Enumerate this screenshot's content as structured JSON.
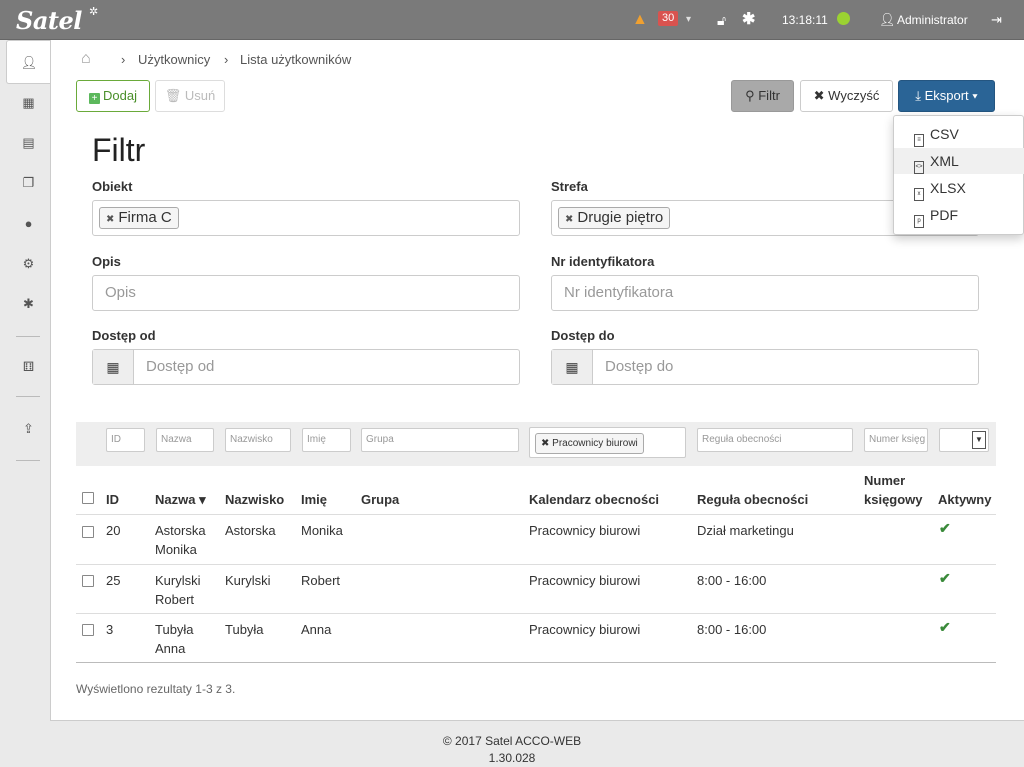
{
  "topbar": {
    "logo": "Satel",
    "alert_count": "30",
    "time": "13:18:11",
    "user": "Administrator",
    "status_color": "#9bd232"
  },
  "breadcrumb": {
    "item1": "Użytkownicy",
    "item2": "Lista użytkowników"
  },
  "toolbar": {
    "add": "Dodaj",
    "delete": "Usuń",
    "filter": "Filtr",
    "clear": "Wyczyść",
    "export": "Eksport"
  },
  "export_menu": [
    {
      "label": "CSV",
      "icon": "csv-file-icon"
    },
    {
      "label": "XML",
      "icon": "xml-file-icon"
    },
    {
      "label": "XLSX",
      "icon": "xlsx-file-icon"
    },
    {
      "label": "PDF",
      "icon": "pdf-file-icon"
    }
  ],
  "filter": {
    "title": "Filtr",
    "object_label": "Obiekt",
    "object_value": "Firma C",
    "zone_label": "Strefa",
    "zone_value": "Drugie piętro",
    "desc_label": "Opis",
    "desc_placeholder": "Opis",
    "card_label": "Nr identyfikatora",
    "card_placeholder": "Nr identyfikatora",
    "from_label": "Dostęp od",
    "from_placeholder": "Dostęp od",
    "to_label": "Dostęp do",
    "to_placeholder": "Dostęp do"
  },
  "table_filters": {
    "id": "ID",
    "name": "Nazwa",
    "surname": "Nazwisko",
    "first": "Imię",
    "group": "Grupa",
    "calendar_tag": "Pracownicy biurowi",
    "rule": "Reguła obecności",
    "ledger": "Numer księg"
  },
  "columns": {
    "id": "ID",
    "name": "Nazwa",
    "surname": "Nazwisko",
    "first": "Imię",
    "group": "Grupa",
    "calendar": "Kalendarz obecności",
    "rule": "Reguła obecności",
    "ledger_1": "Numer",
    "ledger_2": "księgowy",
    "active": "Aktywny"
  },
  "rows": [
    {
      "id": "20",
      "name_1": "Astorska",
      "name_2": "Monika",
      "surname": "Astorska",
      "first": "Monika",
      "group": "",
      "calendar": "Pracownicy biurowi",
      "rule": "Dział marketingu",
      "ledger": "",
      "active": "✔"
    },
    {
      "id": "25",
      "name_1": "Kurylski",
      "name_2": "Robert",
      "surname": "Kurylski",
      "first": "Robert",
      "group": "",
      "calendar": "Pracownicy biurowi",
      "rule": "8:00 - 16:00",
      "ledger": "",
      "active": "✔"
    },
    {
      "id": "3",
      "name_1": "Tubyła",
      "name_2": "Anna",
      "surname": "Tubyła",
      "first": "Anna",
      "group": "",
      "calendar": "Pracownicy biurowi",
      "rule": "8:00 - 16:00",
      "ledger": "",
      "active": "✔"
    }
  ],
  "results": "Wyświetlono rezultaty 1-3 z 3.",
  "footer": {
    "line1_prefix": "© 2017 Satel ",
    "line1_product": "ACCO-WEB",
    "version": "1.30.028"
  },
  "colors": {
    "topbar": "#7a7a7a",
    "export_button": "#2a6496",
    "add_button": "#4a8f2a",
    "active_check": "#3a8a3a"
  }
}
